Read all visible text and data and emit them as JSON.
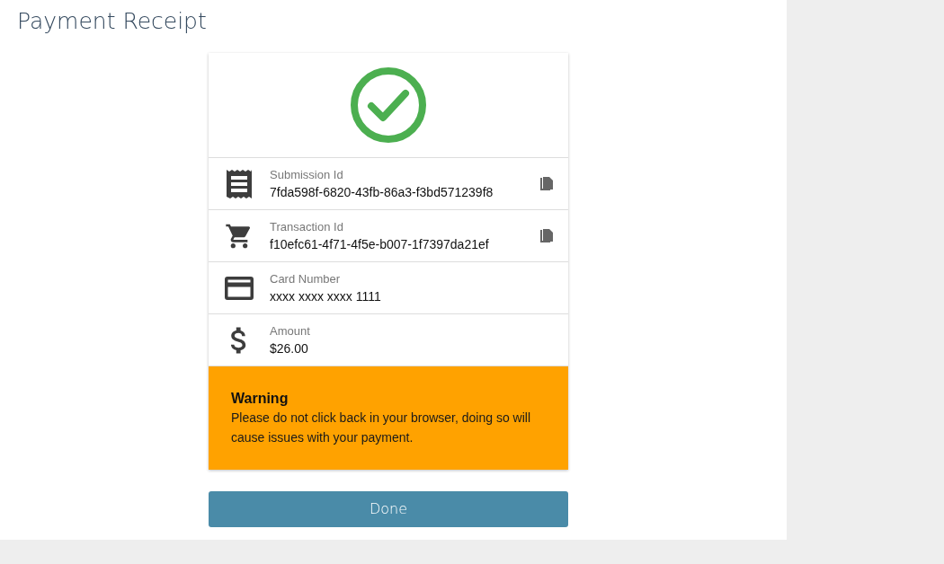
{
  "page_title": "Payment Receipt",
  "status": {
    "kind": "success"
  },
  "fields": [
    {
      "kind": "receipt",
      "label": "Submission Id",
      "value": "7fda598f-6820-43fb-86a3-f3bd571239f8",
      "copyable": true
    },
    {
      "kind": "cart",
      "label": "Transaction Id",
      "value": "f10efc61-4f71-4f5e-b007-1f7397da21ef",
      "copyable": true
    },
    {
      "kind": "card",
      "label": "Card Number",
      "value": "xxxx xxxx xxxx 1111",
      "copyable": false
    },
    {
      "kind": "money",
      "label": "Amount",
      "value": "$26.00",
      "copyable": false
    }
  ],
  "warning": {
    "title": "Warning",
    "message": "Please do not click back in your browser, doing so will cause issues with your payment."
  },
  "done_button": "Done"
}
